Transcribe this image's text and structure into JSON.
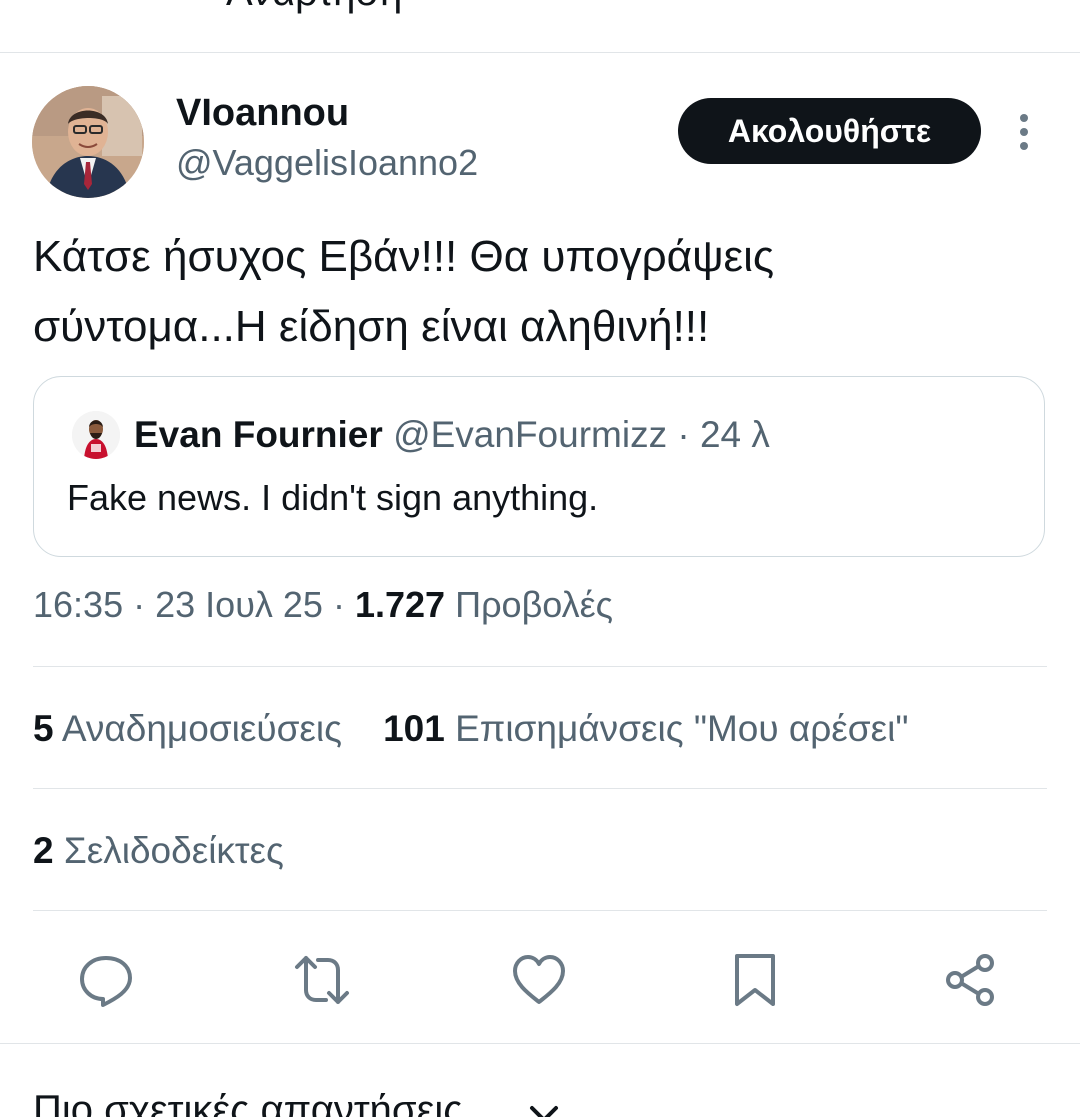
{
  "header": {
    "cut_off_text": "Ανάρτηση"
  },
  "tweet": {
    "author": {
      "display_name": "VIoannou",
      "handle": "@VaggelisIoanno2",
      "avatar_icon": "profile-photo"
    },
    "follow_label": "Ακολουθήστε",
    "more_icon": "vertical-dots-icon",
    "text_line1": "Κάτσε ήσυχος Εβάν!!! Θα υπογράψεις",
    "text_line2": "σύντομα...Η είδηση είναι αληθινή!!!",
    "quoted": {
      "display_name": "Evan Fournier",
      "handle": "@EvanFourmizz",
      "separator": "·",
      "age": "24 λ",
      "text": "Fake news. I didn't sign anything."
    },
    "time": "16:35",
    "date": "23 Ιουλ 25",
    "views_count": "1.727",
    "views_label": "Προβολές",
    "meta_separator": "·"
  },
  "stats": {
    "reposts_count": "5",
    "reposts_label": "Αναδημοσιεύσεις",
    "likes_count": "101",
    "likes_label": "Επισημάνσεις \"Μου αρέσει\"",
    "bookmarks_count": "2",
    "bookmarks_label": "Σελιδοδείκτες"
  },
  "actions": [
    "reply-icon",
    "repost-icon",
    "like-icon",
    "bookmark-icon",
    "share-icon"
  ],
  "replies_sort": {
    "label": "Πιο σχετικές απαντήσεις"
  },
  "colors": {
    "text_primary": "#0f1419",
    "text_secondary": "#536471",
    "divider": "#e1e5e8",
    "button_bg": "#0f1419",
    "icon_gray": "#6b7a86"
  }
}
